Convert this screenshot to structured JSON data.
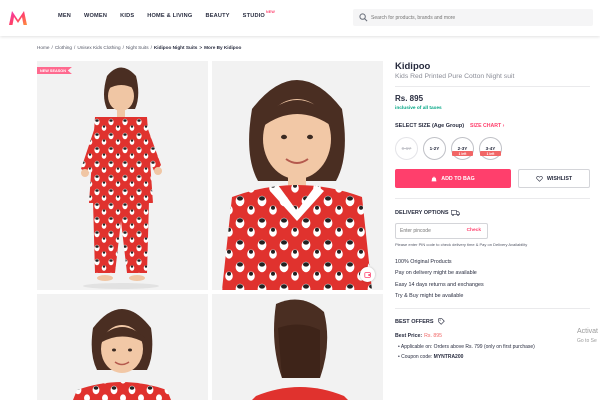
{
  "header": {
    "nav": [
      "MEN",
      "WOMEN",
      "KIDS",
      "HOME & LIVING",
      "BEAUTY",
      "STUDIO"
    ],
    "studio_badge": "NEW",
    "search_placeholder": "Search for products, brands and more"
  },
  "breadcrumb": [
    "Home",
    "Clothing",
    "Unisex Kids Clothing",
    "Night Suits",
    "Kidipoo Night Suits",
    "More By Kidipoo"
  ],
  "gallery": {
    "badge": "NEW SEASON"
  },
  "product": {
    "brand": "Kidipoo",
    "name": "Kids Red Printed Pure Cotton Night suit",
    "price": "Rs. 895",
    "tax_note": "inclusive of all taxes",
    "size_label": "SELECT SIZE (Age Group)",
    "size_chart": "SIZE CHART",
    "sizes": [
      {
        "label": "0-1Y",
        "left": "",
        "available": false
      },
      {
        "label": "1-2Y",
        "left": "",
        "available": true
      },
      {
        "label": "2-3Y",
        "left": "1 left",
        "available": true
      },
      {
        "label": "3-4Y",
        "left": "1 left",
        "available": true
      }
    ],
    "add_to_bag": "ADD TO BAG",
    "wishlist": "WISHLIST"
  },
  "delivery": {
    "title": "DELIVERY OPTIONS",
    "pincode_placeholder": "Enter pincode",
    "check": "Check",
    "note": "Please enter PIN code to check delivery time & Pay on Delivery Availability",
    "features": [
      "100% Original Products",
      "Pay on delivery might be available",
      "Easy 14 days returns and exchanges",
      "Try & Buy might be available"
    ]
  },
  "offers": {
    "title": "BEST OFFERS",
    "best_price_label": "Best Price:",
    "best_price_value": "Rs. 895",
    "lines": [
      {
        "text": "Applicable on: Orders above Rs. 799 (only on first purchase)"
      },
      {
        "label": "Coupon code: ",
        "code": "MYNTRA200"
      }
    ]
  },
  "watermark": {
    "line1": "Activat",
    "line2": "Go to Se"
  },
  "colors": {
    "brand_pink": "#ff3f6c",
    "teal": "#03a685",
    "kids_red": "#e0322e"
  }
}
